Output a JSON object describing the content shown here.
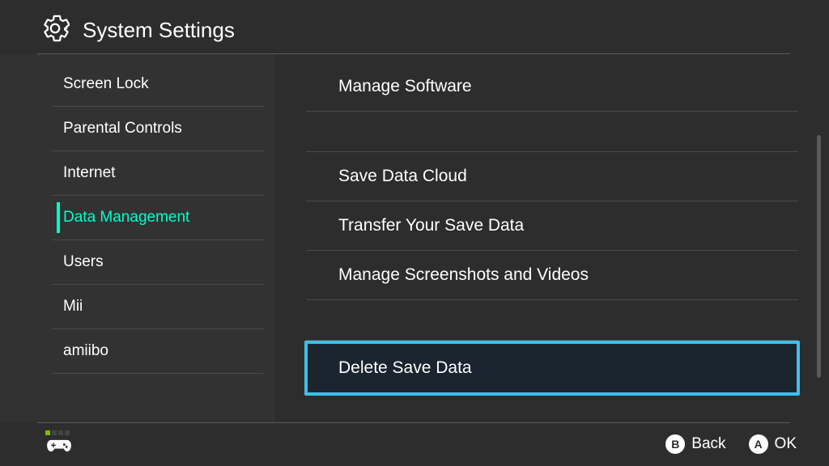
{
  "header": {
    "title": "System Settings"
  },
  "sidebar": {
    "items": [
      {
        "label": "Screen Lock",
        "selected": false
      },
      {
        "label": "Parental Controls",
        "selected": false
      },
      {
        "label": "Internet",
        "selected": false
      },
      {
        "label": "Data Management",
        "selected": true
      },
      {
        "label": "Users",
        "selected": false
      },
      {
        "label": "Mii",
        "selected": false
      },
      {
        "label": "amiibo",
        "selected": false
      }
    ]
  },
  "main": {
    "items": [
      {
        "label": "Manage Software",
        "highlighted": false,
        "gap_after": true
      },
      {
        "label": "Save Data Cloud",
        "highlighted": false,
        "gap_after": false
      },
      {
        "label": "Transfer Your Save Data",
        "highlighted": false,
        "gap_after": false
      },
      {
        "label": "Manage Screenshots and Videos",
        "highlighted": false,
        "gap_after": true
      },
      {
        "label": "Delete Save Data",
        "highlighted": true,
        "gap_after": false
      }
    ]
  },
  "footer": {
    "back_glyph": "B",
    "back_label": "Back",
    "ok_glyph": "A",
    "ok_label": "OK"
  }
}
